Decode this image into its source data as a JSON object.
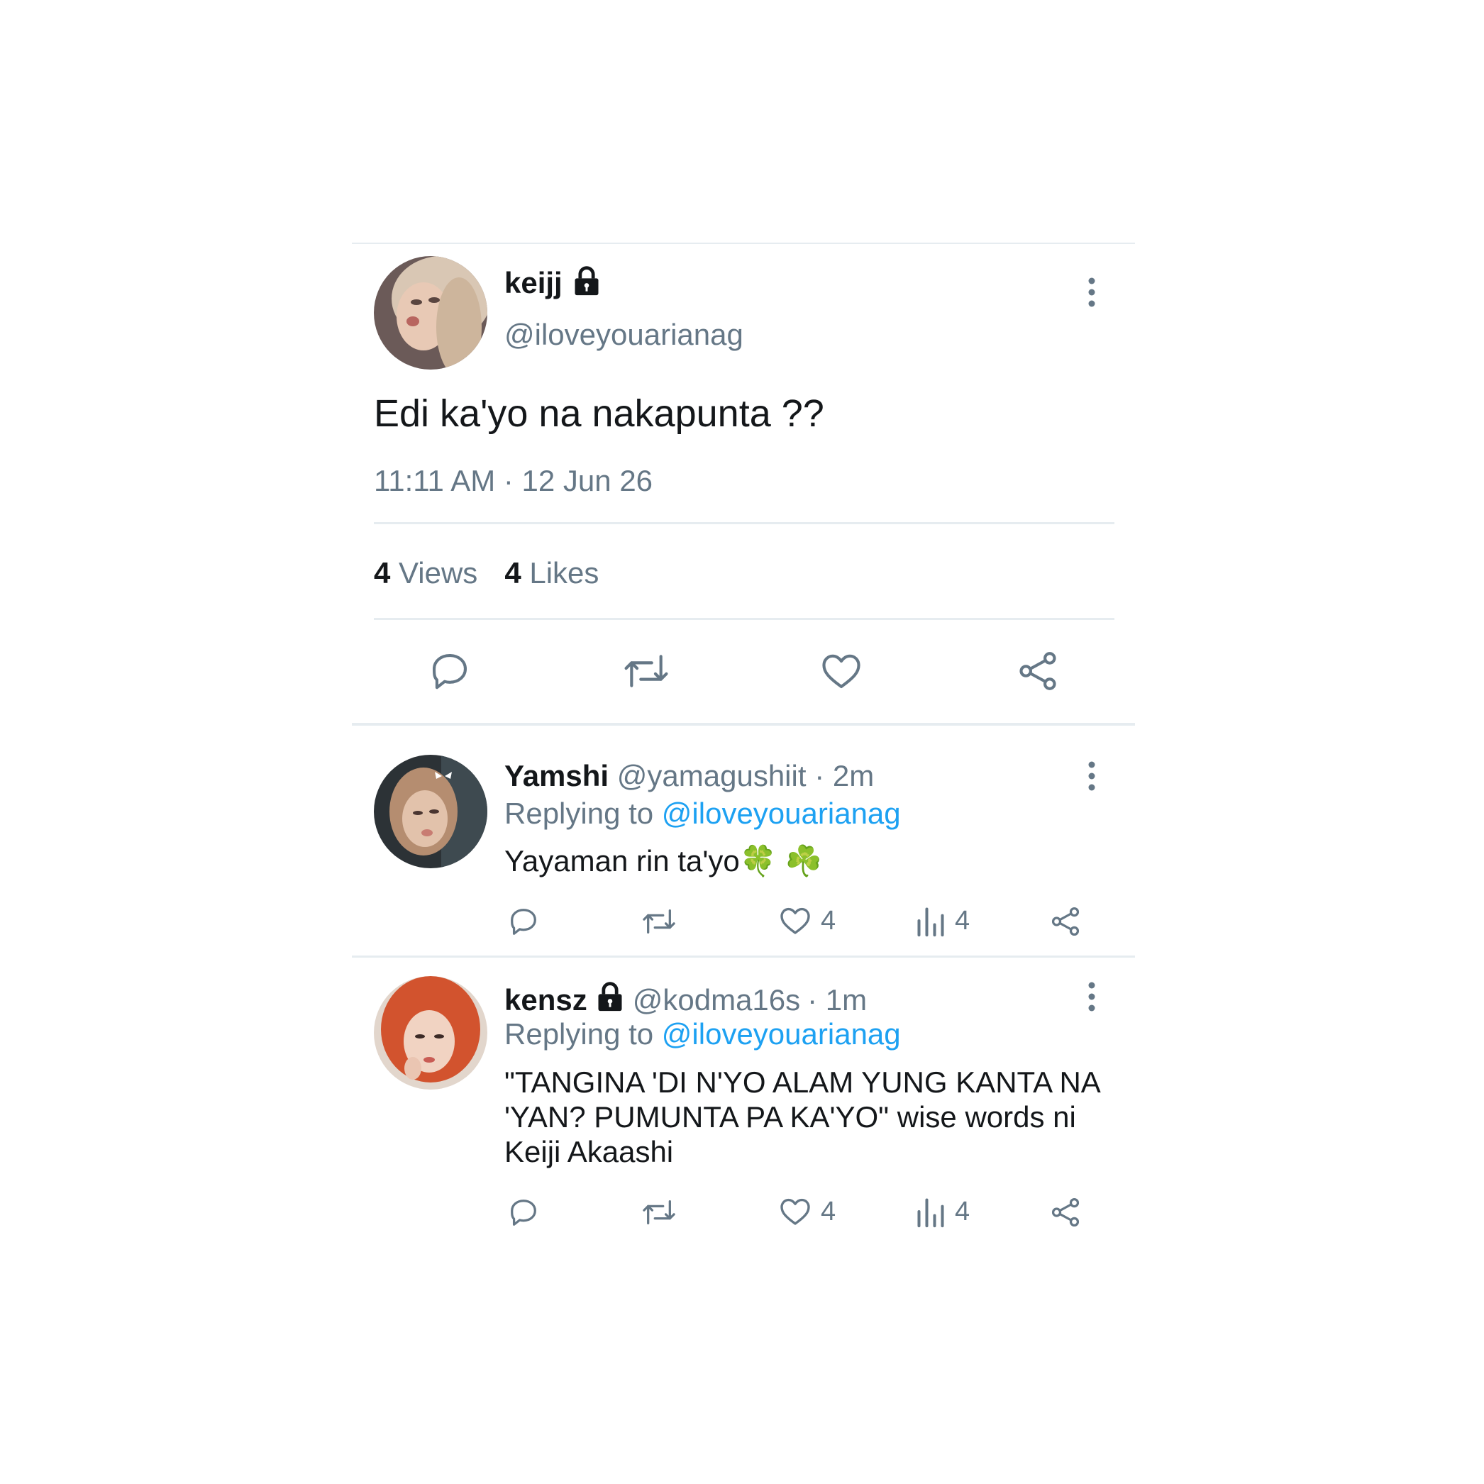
{
  "main_tweet": {
    "display_name": "keijj",
    "handle": "@iloveyouarianag",
    "text": "Edi ka'yo na nakapunta ??",
    "timestamp": "11:11 AM · 12 Jun 26",
    "views_count": "4",
    "views_label": "Views",
    "likes_count": "4",
    "likes_label": "Likes",
    "locked": true
  },
  "replies": [
    {
      "display_name": "Yamshi",
      "handle": "@yamagushiit",
      "time": "· 2m",
      "replying_to_label": "Replying to",
      "replying_to_handle": "@iloveyouarianag",
      "text": "Yayaman rin ta'yo",
      "emoji": "🍀 ☘️",
      "like_count": "4",
      "view_count": "4",
      "locked": false
    },
    {
      "display_name": "kensz",
      "handle": "@kodma16s",
      "time": "· 1m",
      "replying_to_label": "Replying to",
      "replying_to_handle": "@iloveyouarianag",
      "text": "\"TANGINA 'DI N'YO ALAM YUNG KANTA NA 'YAN? PUMUNTA PA KA'YO\" wise words ni Keiji Akaashi",
      "like_count": "4",
      "view_count": "4",
      "locked": true
    }
  ],
  "colors": {
    "text": "#14171a",
    "muted": "#657786",
    "link": "#1da1f2",
    "divider": "#e6ecf0"
  },
  "icons": [
    "lock-icon",
    "more-options-icon",
    "reply-icon",
    "retweet-icon",
    "like-icon",
    "views-icon",
    "share-icon"
  ]
}
